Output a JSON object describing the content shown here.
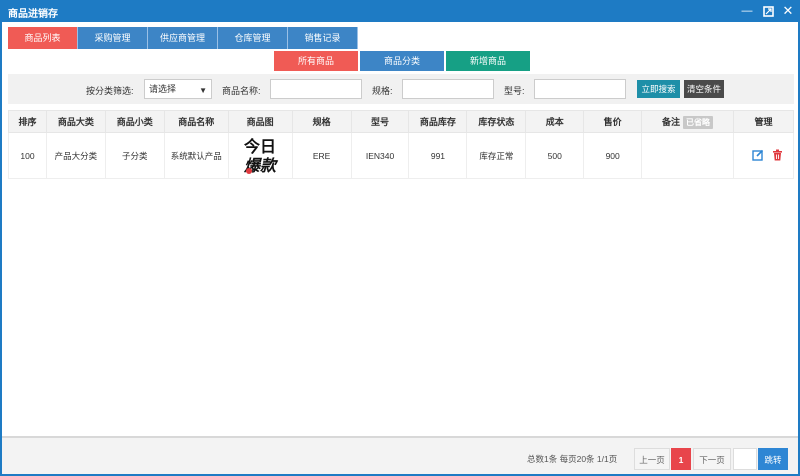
{
  "window": {
    "title": "商品进销存"
  },
  "tabs": [
    {
      "label": "商品列表",
      "active": true
    },
    {
      "label": "采购管理",
      "active": false
    },
    {
      "label": "供应商管理",
      "active": false
    },
    {
      "label": "仓库管理",
      "active": false
    },
    {
      "label": "销售记录",
      "active": false
    }
  ],
  "subtabs": {
    "all_products": "所有商品",
    "categories": "商品分类",
    "add_product": "新增商品"
  },
  "filter": {
    "category_label": "按分类筛选:",
    "category_select_value": "请选择",
    "name_label": "商品名称:",
    "spec_label": "规格:",
    "model_label": "型号:",
    "search_button": "立即搜索",
    "clear_button": "清空条件"
  },
  "table": {
    "headers": [
      "排序",
      "商品大类",
      "商品小类",
      "商品名称",
      "商品图",
      "规格",
      "型号",
      "商品库存",
      "库存状态",
      "成本",
      "售价",
      "备注",
      "管理"
    ],
    "remark_badge": "已省略",
    "rows": [
      {
        "order": "100",
        "major_category": "产品大分类",
        "minor_category": "子分类",
        "name": "系统默认产品",
        "image_text_top": "今日",
        "image_text_bottom": "爆款",
        "spec": "ERE",
        "model": "IEN340",
        "stock": "991",
        "stock_status": "库存正常",
        "cost": "500",
        "price": "900",
        "remark": ""
      }
    ]
  },
  "pagination": {
    "summary": "总数1条 每页20条 1/1页",
    "prev": "上一页",
    "current": "1",
    "next": "下一页",
    "jump": "跳转"
  },
  "colors": {
    "titlebar": "#1e7bc4",
    "tab_active": "#f05b55",
    "tab_normal": "#3d85c6",
    "subtab_all": "#f05b55",
    "subtab_category": "#3d85c6",
    "subtab_add": "#16a085",
    "search_button": "#1e8fa8",
    "clear_button": "#4a4a4a",
    "edit_icon": "#2e86d4",
    "delete_icon": "#e0393e"
  }
}
